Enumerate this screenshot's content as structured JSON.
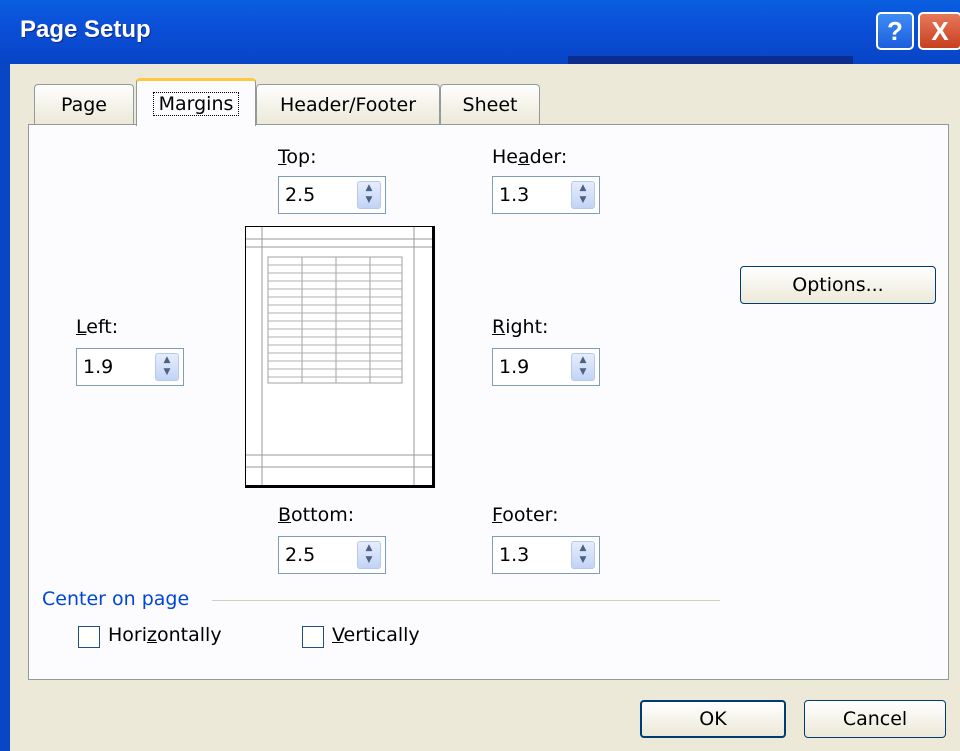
{
  "window": {
    "title": "Page Setup",
    "help_glyph": "?",
    "close_glyph": "X"
  },
  "tabs": [
    {
      "label": "Page"
    },
    {
      "label": "Margins"
    },
    {
      "label": "Header/Footer"
    },
    {
      "label": "Sheet"
    }
  ],
  "margins": {
    "top": {
      "label": "Top:",
      "value": "2.5"
    },
    "header": {
      "label": "Header:",
      "value": "1.3"
    },
    "left": {
      "label": "Left:",
      "value": "1.9"
    },
    "right": {
      "label": "Right:",
      "value": "1.9"
    },
    "bottom": {
      "label": "Bottom:",
      "value": "2.5"
    },
    "footer": {
      "label": "Footer:",
      "value": "1.3"
    }
  },
  "options_button": "Options...",
  "center_on_page": {
    "label": "Center on page",
    "horizontally": "Horizontally",
    "vertically": "Vertically"
  },
  "ok_button": "OK",
  "cancel_button": "Cancel",
  "icons": {
    "spin_arrows": "spin-arrows-icon"
  },
  "colors": {
    "title_bar": "#0b4fd8",
    "group_label": "#0046d5",
    "active_tab_accent": "#ffc73c"
  }
}
